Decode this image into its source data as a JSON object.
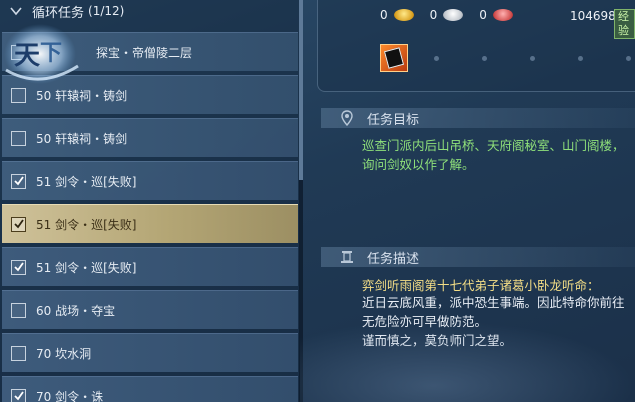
{
  "task_list": {
    "header_title": "循环任务",
    "header_count": "(1/12)",
    "items": [
      {
        "label": "探宝・帝僧陵二层",
        "checked": false,
        "selected": false
      },
      {
        "label": "50 轩辕祠・铸剑",
        "checked": false,
        "selected": false
      },
      {
        "label": "50 轩辕祠・铸剑",
        "checked": false,
        "selected": false
      },
      {
        "label": "51 剑令・巡[失败]",
        "checked": true,
        "selected": false
      },
      {
        "label": "51 剑令・巡[失败]",
        "checked": true,
        "selected": true
      },
      {
        "label": "51 剑令・巡[失败]",
        "checked": true,
        "selected": false
      },
      {
        "label": "60 战场・夺宝",
        "checked": false,
        "selected": false
      },
      {
        "label": "70 坎水洞",
        "checked": false,
        "selected": false
      },
      {
        "label": "70 剑令・诛",
        "checked": true,
        "selected": false
      }
    ]
  },
  "logo_text": "天下",
  "rewards": {
    "gold": "0",
    "silver": "0",
    "red": "0",
    "exp_value": "104698",
    "exp_label": "经验",
    "item_icon": "scroll-item-icon"
  },
  "goal": {
    "title": "任务目标",
    "text": "巡查门派内后山吊桥、天府阁秘室、山门阁楼，\n询问剑奴以作了解。"
  },
  "description": {
    "title": "任务描述",
    "speaker_line": "弈剑听雨阁第十七代弟子诸葛小卧龙听命：",
    "text": "近日云底风重，派中恐生事端。因此特命你前往\n无危险亦可早做防范。\n谨而慎之，莫负师门之望。"
  },
  "colors": {
    "goal_text": "#8fe07a",
    "speaker_text": "#f3dd86",
    "selected_row": "#b4a675"
  }
}
